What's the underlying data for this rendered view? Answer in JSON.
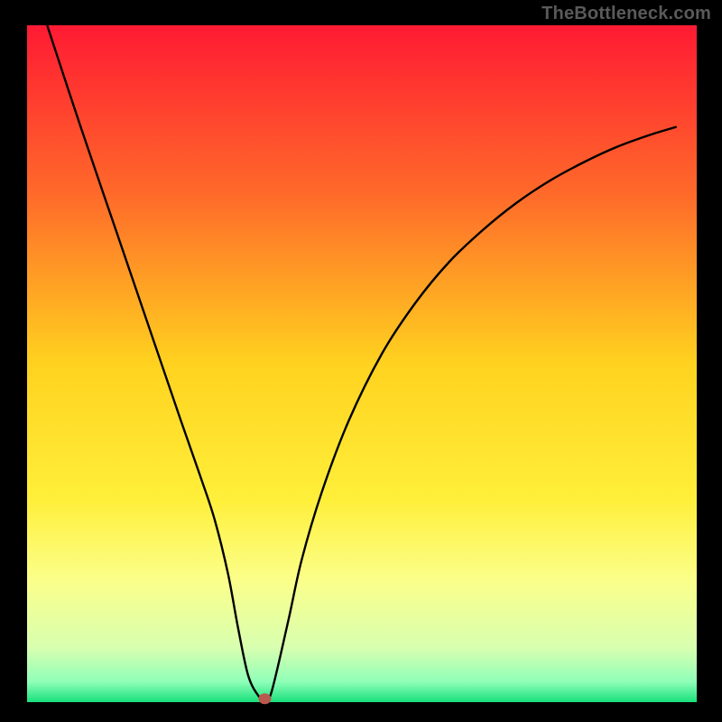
{
  "watermark": "TheBottleneck.com",
  "chart_data": {
    "type": "line",
    "title": "",
    "xlabel": "",
    "ylabel": "",
    "xlim": [
      0,
      100
    ],
    "ylim": [
      0,
      100
    ],
    "grid": false,
    "legend": false,
    "background_gradient": {
      "stops": [
        {
          "pos": 0.0,
          "color": "#ff1a33"
        },
        {
          "pos": 0.25,
          "color": "#ff6a2a"
        },
        {
          "pos": 0.5,
          "color": "#ffd21f"
        },
        {
          "pos": 0.7,
          "color": "#ffef3a"
        },
        {
          "pos": 0.82,
          "color": "#fbff8a"
        },
        {
          "pos": 0.92,
          "color": "#d8ffb0"
        },
        {
          "pos": 0.97,
          "color": "#8fffb8"
        },
        {
          "pos": 1.0,
          "color": "#18e07a"
        }
      ]
    },
    "series": [
      {
        "name": "curve",
        "x": [
          3.0,
          8.0,
          13.0,
          18.0,
          23.0,
          26.0,
          28.0,
          30.0,
          31.5,
          33.0,
          34.5,
          35.5,
          36.5,
          39.0,
          41.0,
          44.0,
          48.0,
          53.0,
          58.0,
          63.0,
          68.0,
          73.0,
          78.0,
          83.0,
          88.0,
          93.0,
          97.0
        ],
        "y": [
          100.0,
          85.0,
          70.5,
          56.0,
          41.5,
          33.0,
          27.0,
          19.0,
          11.0,
          4.0,
          1.0,
          0.5,
          1.5,
          12.0,
          21.0,
          31.0,
          41.5,
          51.5,
          59.0,
          65.0,
          69.7,
          73.7,
          77.0,
          79.7,
          82.0,
          83.8,
          85.0
        ]
      }
    ],
    "marker": {
      "x": 35.5,
      "y": 0.5,
      "color": "#b9584f"
    }
  }
}
